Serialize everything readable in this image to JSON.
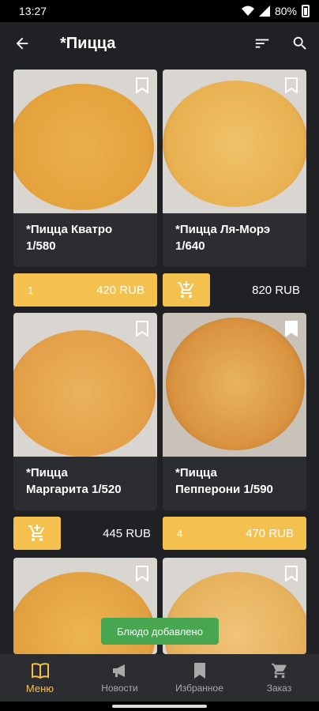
{
  "status_bar": {
    "time": "13:27",
    "battery": "80%"
  },
  "header": {
    "title": "*Пицца"
  },
  "products": [
    {
      "name_line1": "*Пицца Кватро",
      "name_line2": "1/580",
      "quantity": "1",
      "price": "420 RUB",
      "in_cart": true
    },
    {
      "name_line1": "*Пицца Ля-Морэ",
      "name_line2": "1/640",
      "quantity": "",
      "price": "820 RUB",
      "in_cart": false
    },
    {
      "name_line1": "*Пицца",
      "name_line2": "Маргарита 1/520",
      "quantity": "",
      "price": "445 RUB",
      "in_cart": false
    },
    {
      "name_line1": "*Пицца",
      "name_line2": "Пепперони 1/590",
      "quantity": "4",
      "price": "470 RUB",
      "in_cart": true
    }
  ],
  "toast": {
    "text": "Блюдо добавлено"
  },
  "bottom_nav": {
    "items": [
      {
        "label": "Меню",
        "icon": "book-icon",
        "active": true
      },
      {
        "label": "Новости",
        "icon": "megaphone-icon",
        "active": false
      },
      {
        "label": "Избранное",
        "icon": "bookmark-icon",
        "active": false
      },
      {
        "label": "Заказ",
        "icon": "cart-icon",
        "active": false
      }
    ]
  },
  "colors": {
    "accent": "#f5c14e",
    "background": "#202124",
    "card": "#2c2d30",
    "toast": "#48a550"
  }
}
